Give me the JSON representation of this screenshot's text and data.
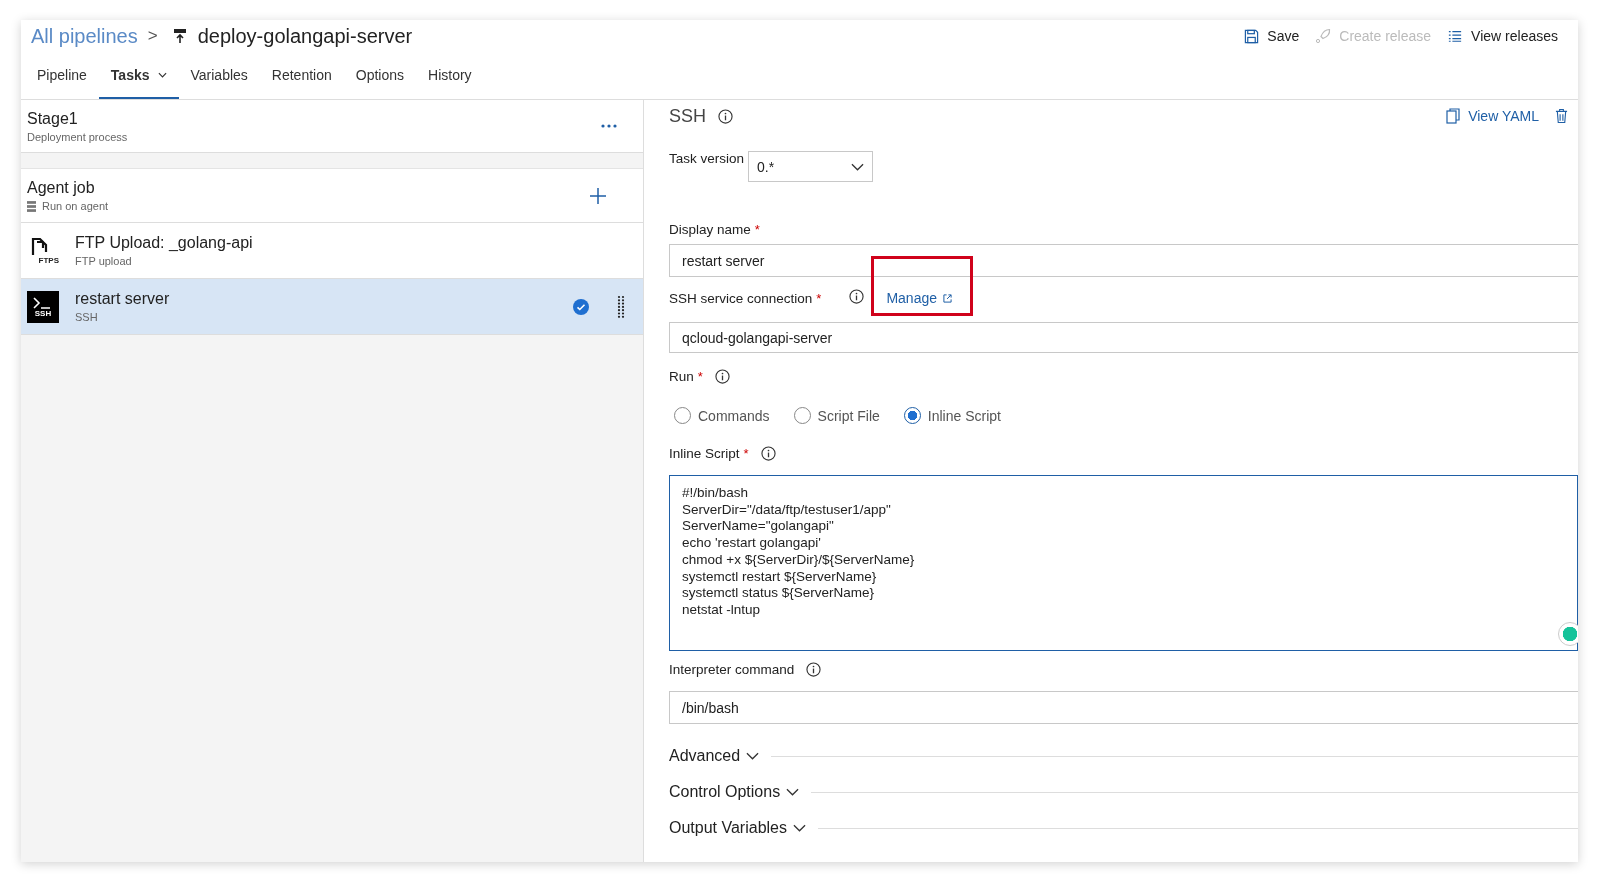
{
  "breadcrumb": {
    "parent": "All pipelines",
    "separator": ">",
    "title": "deploy-golangapi-server"
  },
  "actions": [
    {
      "label": "Save",
      "kind": "save",
      "disabled": false
    },
    {
      "label": "Create release",
      "kind": "release",
      "disabled": true
    },
    {
      "label": "View releases",
      "kind": "list",
      "disabled": false
    }
  ],
  "tabs": [
    {
      "label": "Pipeline",
      "selected": false,
      "dropdown": false
    },
    {
      "label": "Tasks",
      "selected": true,
      "dropdown": true
    },
    {
      "label": "Variables",
      "selected": false,
      "dropdown": false
    },
    {
      "label": "Retention",
      "selected": false,
      "dropdown": false
    },
    {
      "label": "Options",
      "selected": false,
      "dropdown": false
    },
    {
      "label": "History",
      "selected": false,
      "dropdown": false
    }
  ],
  "stage": {
    "title": "Stage1",
    "subtitle": "Deployment process"
  },
  "job": {
    "title": "Agent job",
    "subtitle": "Run on agent"
  },
  "tasks": [
    {
      "kind": "ftp",
      "icon_label": "FTPS",
      "title": "FTP Upload: _golang-api",
      "subtitle": "FTP upload",
      "selected": false
    },
    {
      "kind": "ssh",
      "icon_label": "SSH",
      "title": "restart server",
      "subtitle": "SSH",
      "selected": true
    }
  ],
  "detail": {
    "title": "SSH",
    "view_yaml": "View YAML",
    "task_version": {
      "label": "Task version",
      "value": "0.*"
    },
    "display_name": {
      "label": "Display name",
      "required_mark": "*",
      "value": "restart server"
    },
    "connection": {
      "label": "SSH service connection",
      "required_mark": "*",
      "manage": "Manage",
      "value": "qcloud-golangapi-server"
    },
    "run": {
      "label": "Run",
      "required_mark": "*",
      "options": [
        {
          "label": "Commands",
          "selected": false
        },
        {
          "label": "Script File",
          "selected": false
        },
        {
          "label": "Inline Script",
          "selected": true
        }
      ]
    },
    "inline_script": {
      "label": "Inline Script",
      "required_mark": "*",
      "value": "#!/bin/bash\nServerDir=\"/data/ftp/testuser1/app\"\nServerName=\"golangapi\"\necho 'restart golangapi'\nchmod +x ${ServerDir}/${ServerName}\nsystemctl restart ${ServerName}\nsystemctl status ${ServerName}\nnetstat -lntup"
    },
    "interpreter": {
      "label": "Interpreter command",
      "value": "/bin/bash"
    },
    "sections": [
      {
        "label": "Advanced"
      },
      {
        "label": "Control Options"
      },
      {
        "label": "Output Variables"
      }
    ]
  }
}
